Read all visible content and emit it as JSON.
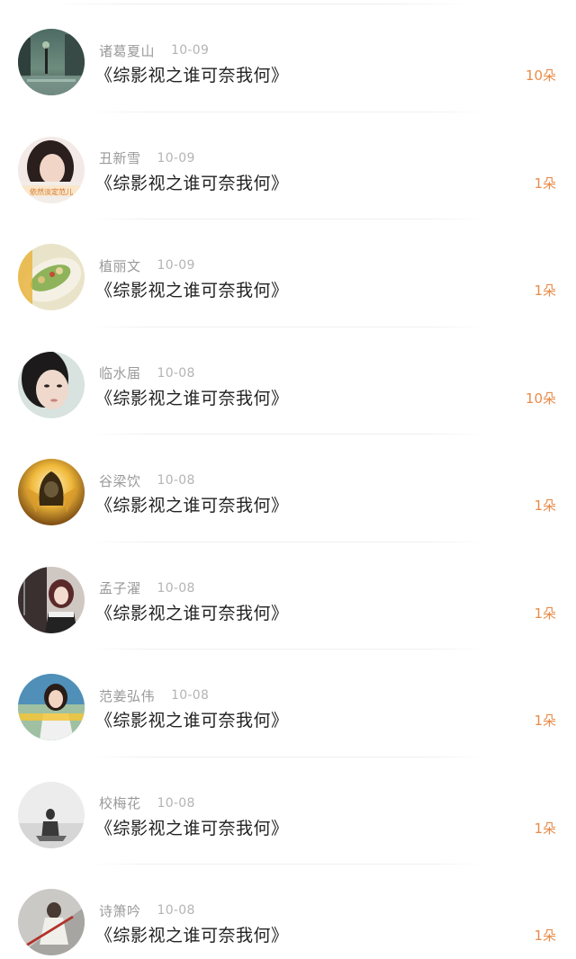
{
  "colors": {
    "name": "#9a9a9a",
    "date": "#b4b4b4",
    "title": "#222222",
    "flowers": "#e88c4a"
  },
  "entries": [
    {
      "name": "诸葛夏山",
      "date": "10-09",
      "book": "《综影视之谁可奈我何》",
      "flowers": "10朵",
      "avatar_icon": "rainy-street-avatar"
    },
    {
      "name": "丑新雪",
      "date": "10-09",
      "book": "《综影视之谁可奈我何》",
      "flowers": "1朵",
      "avatar_icon": "girl-portrait-avatar",
      "avatar_caption": "依然淡定范儿"
    },
    {
      "name": "植丽文",
      "date": "10-09",
      "book": "《综影视之谁可奈我何》",
      "flowers": "1朵",
      "avatar_icon": "food-plate-avatar"
    },
    {
      "name": "临水届",
      "date": "10-08",
      "book": "《综影视之谁可奈我何》",
      "flowers": "10朵",
      "avatar_icon": "woman-face-avatar"
    },
    {
      "name": "谷梁饮",
      "date": "10-08",
      "book": "《综影视之谁可奈我何》",
      "flowers": "1朵",
      "avatar_icon": "golden-warrior-avatar"
    },
    {
      "name": "孟子濯",
      "date": "10-08",
      "book": "《综影视之谁可奈我何》",
      "flowers": "1朵",
      "avatar_icon": "girl-outdoor-avatar"
    },
    {
      "name": "范姜弘伟",
      "date": "10-08",
      "book": "《综影视之谁可奈我何》",
      "flowers": "1朵",
      "avatar_icon": "girl-city-avatar"
    },
    {
      "name": "校梅花",
      "date": "10-08",
      "book": "《综影视之谁可奈我何》",
      "flowers": "1朵",
      "avatar_icon": "silhouette-gray-avatar"
    },
    {
      "name": "诗箫吟",
      "date": "10-08",
      "book": "《综影视之谁可奈我何》",
      "flowers": "1朵",
      "avatar_icon": "swordsman-avatar"
    }
  ]
}
